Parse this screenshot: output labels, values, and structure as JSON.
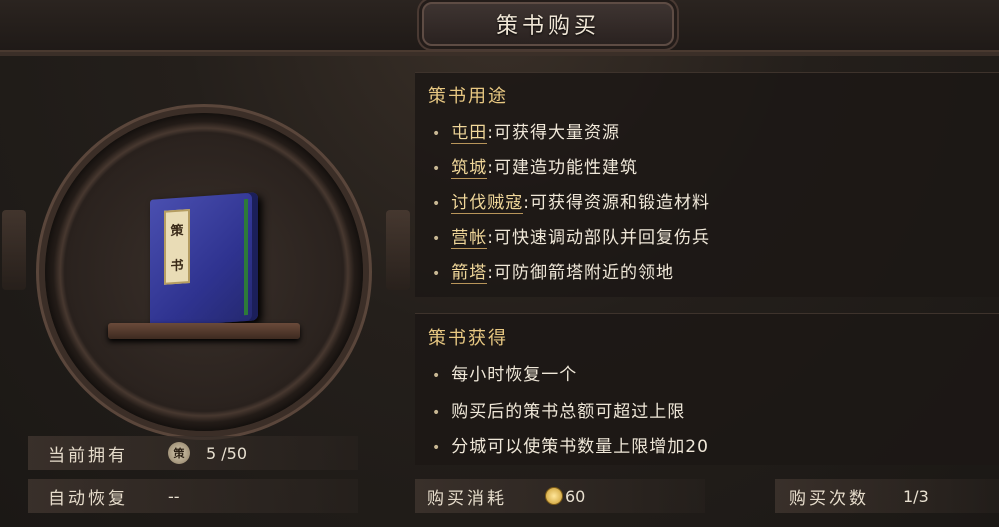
{
  "header": {
    "title": "策书购买"
  },
  "book": {
    "label_chars": [
      "策",
      "书"
    ]
  },
  "stats": {
    "owned_label": "当前拥有",
    "owned_token": "策",
    "owned_value": "5 /50",
    "recover_label": "自动恢复",
    "recover_value": "--"
  },
  "usage": {
    "title": "策书用途",
    "items": [
      {
        "keyword": "屯田",
        "desc": ":可获得大量资源"
      },
      {
        "keyword": "筑城",
        "desc": ":可建造功能性建筑"
      },
      {
        "keyword": "讨伐贼寇",
        "desc": ":可获得资源和锻造材料"
      },
      {
        "keyword": "营帐",
        "desc": ":可快速调动部队并回复伤兵"
      },
      {
        "keyword": "箭塔",
        "desc": ":可防御箭塔附近的领地"
      }
    ]
  },
  "obtain": {
    "title": "策书获得",
    "items": [
      "每小时恢复一个",
      "购买后的策书总额可超过上限",
      "分城可以使策书数量上限增加20"
    ]
  },
  "purchase": {
    "cost_label": "购买消耗",
    "cost_value": "60",
    "count_label": "购买次数",
    "count_value": "1/3"
  },
  "colors": {
    "accent_gold": "#f0d79a",
    "section_title": "#e8c882",
    "book_cover": "#2f3390"
  }
}
